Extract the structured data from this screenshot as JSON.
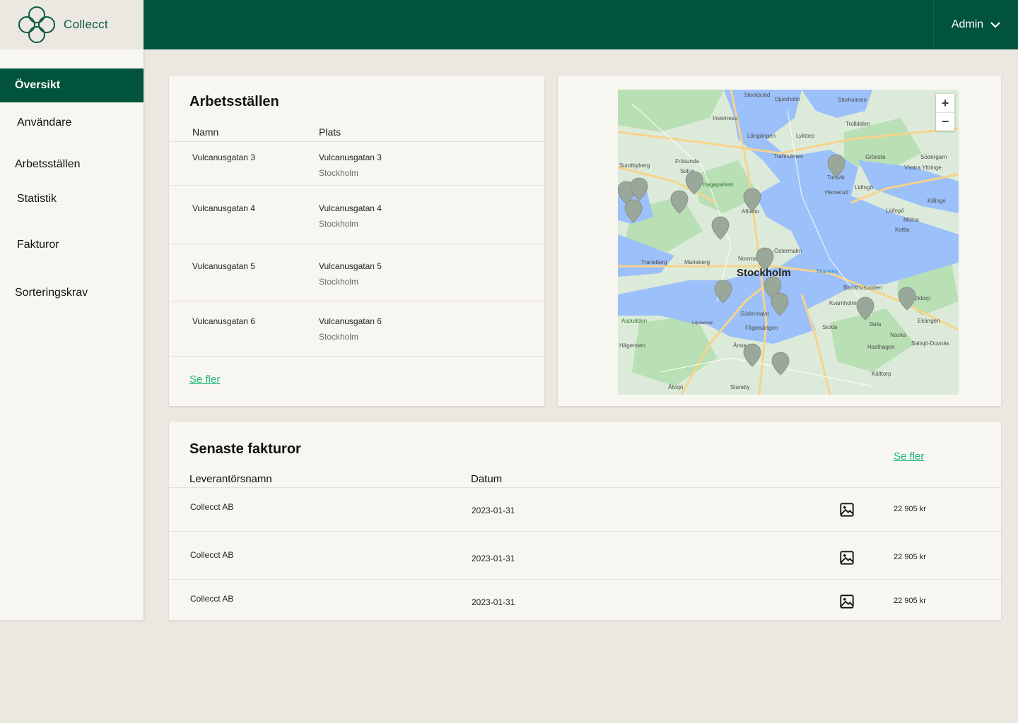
{
  "brand": {
    "name": "Collecct"
  },
  "header": {
    "user_label": "Admin"
  },
  "sidebar": {
    "items": [
      {
        "label": "Översikt",
        "active": true
      },
      {
        "label": "Användare"
      },
      {
        "label": "Arbetsställen"
      },
      {
        "label": "Statistik"
      },
      {
        "label": "Fakturor"
      },
      {
        "label": "Sorteringskrav"
      }
    ]
  },
  "workplaces": {
    "title": "Arbetsställen",
    "columns": [
      "Namn",
      "Plats"
    ],
    "rows": [
      {
        "name": "Vulcanusgatan 3",
        "place": "Vulcanusgatan 3",
        "city": "Stockholm"
      },
      {
        "name": "Vulcanusgatan 4",
        "place": "Vulcanusgatan 4",
        "city": "Stockholm"
      },
      {
        "name": "Vulcanusgatan 5",
        "place": "Vulcanusgatan 5",
        "city": "Stockholm"
      },
      {
        "name": "Vulcanusgatan 6",
        "place": "Vulcanusgatan 6",
        "city": "Stockholm"
      }
    ],
    "more_link": "Se fler"
  },
  "map": {
    "city_label": "Stockholm",
    "labels": [
      "Djursholm",
      "Stocksund",
      "Sundbyberg",
      "Solna",
      "Lidingö",
      "Hagaparken",
      "Norrmalm",
      "Östermalm",
      "Södermalm",
      "Sickla",
      "Nacka",
      "Hägersten",
      "Älvsjö",
      "Stureby",
      "Blockhusudden",
      "Kvarnholmen",
      "Järla",
      "Ektorp",
      "Kottla",
      "Mölna",
      "Killinge",
      "Torsvik",
      "Herserud",
      "Tranholmen",
      "Lyktorp",
      "Långängen",
      "Traneberg",
      "Marieberg",
      "Årsta",
      "Hasthagen",
      "Fågelsången",
      "Saltsjö-Duvnäs",
      "Ekängen",
      "Kälttorp",
      "Skansen",
      "Albano",
      "Frösunda",
      "Inverness",
      "Storholmen",
      "Trolldalen",
      "Grönsta",
      "Södergarn",
      "Västra Yttringe",
      "Lidingö",
      "Aspudden",
      "Liljeholmen"
    ],
    "zoom_in": "+",
    "zoom_out": "−",
    "colors": {
      "land": "#dcebd9",
      "park": "#b9dfb4",
      "water": "#9cc0f9",
      "road": "#f7d38a",
      "marker": "#9aa79b"
    }
  },
  "invoices": {
    "title": "Senaste fakturor",
    "columns": [
      "Leverantörsnamn",
      "Datum"
    ],
    "more_link": "Se fler",
    "rows": [
      {
        "supplier": "Collecct AB",
        "date": "2023-01-31",
        "amount": "22 905 kr"
      },
      {
        "supplier": "Collecct AB",
        "date": "2023-01-31",
        "amount": "22 905 kr"
      },
      {
        "supplier": "Collecct AB",
        "date": "2023-01-31",
        "amount": "22 905 kr"
      }
    ]
  },
  "icons": {
    "logo": "four-circle-logo-icon",
    "admin_menu": "chevron-down-icon",
    "invoice_image": "image-icon"
  }
}
